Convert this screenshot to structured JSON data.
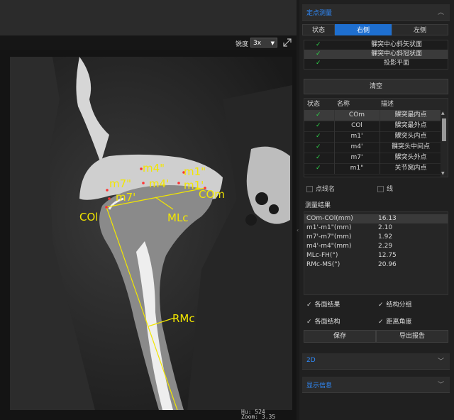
{
  "viewer": {
    "sharpness_label": "锐度",
    "zoom_select_value": "3x",
    "overlay_labels": {
      "m4pp": "m4\"",
      "m1pp": "m1\"",
      "m7pp": "m7\"",
      "m4p": "m4'",
      "m1p": "m1'",
      "com": "COm",
      "m7p": "m7'",
      "col": "COl",
      "mlc": "MLc",
      "rmc": "RMc"
    },
    "hu_readout": "Hu: 524",
    "zoom_readout": "Zoom: 3.35",
    "overlay_color": "#f2e600"
  },
  "panel": {
    "point_measure_title": "定点测量",
    "side_tabs": [
      "状态",
      "右侧",
      "左侧"
    ],
    "active_tab": "右侧",
    "planes": [
      {
        "status": "✓",
        "label": "髁突中心斜矢状面",
        "selected": false
      },
      {
        "status": "✓",
        "label": "髁突中心斜冠状面",
        "selected": true
      },
      {
        "status": "✓",
        "label": "投影平面",
        "selected": false
      }
    ],
    "clear_button": "清空",
    "point_table": {
      "headers": [
        "状态",
        "名称",
        "描述"
      ],
      "rows": [
        {
          "status": "✓",
          "name": "COm",
          "desc": "髁突最内点",
          "selected": true
        },
        {
          "status": "✓",
          "name": "COl",
          "desc": "髁突最外点",
          "selected": false
        },
        {
          "status": "✓",
          "name": "m1'",
          "desc": "髁突头内点",
          "selected": false
        },
        {
          "status": "✓",
          "name": "m4'",
          "desc": "髁突头中间点",
          "selected": false
        },
        {
          "status": "✓",
          "name": "m7'",
          "desc": "髁突头外点",
          "selected": false
        },
        {
          "status": "✓",
          "name": "m1\"",
          "desc": "关节窝内点",
          "selected": false
        }
      ]
    },
    "point_name_option": "点线名",
    "line_option": "线",
    "results_label": "测量结果",
    "results": [
      {
        "name": "COm-COl(mm)",
        "value": "16.13"
      },
      {
        "name": "m1'-m1\"(mm)",
        "value": "2.10"
      },
      {
        "name": "m7'-m7\"(mm)",
        "value": "1.92"
      },
      {
        "name": "m4'-m4\"(mm)",
        "value": "2.29"
      },
      {
        "name": "MLc-FH(°)",
        "value": "12.75"
      },
      {
        "name": "RMc-MS(°)",
        "value": "20.96"
      }
    ],
    "checkboxes": {
      "each_plane_result": "各面结果",
      "structure_group": "结构分组",
      "each_plane_structure": "各面结构",
      "distance_angle": "距离角度"
    },
    "save_button": "保存",
    "export_button": "导出报告",
    "section_2d_title": "2D",
    "display_info_title": "显示信息",
    "accent_color": "#2f8cff",
    "check_color": "#2fd24a"
  }
}
